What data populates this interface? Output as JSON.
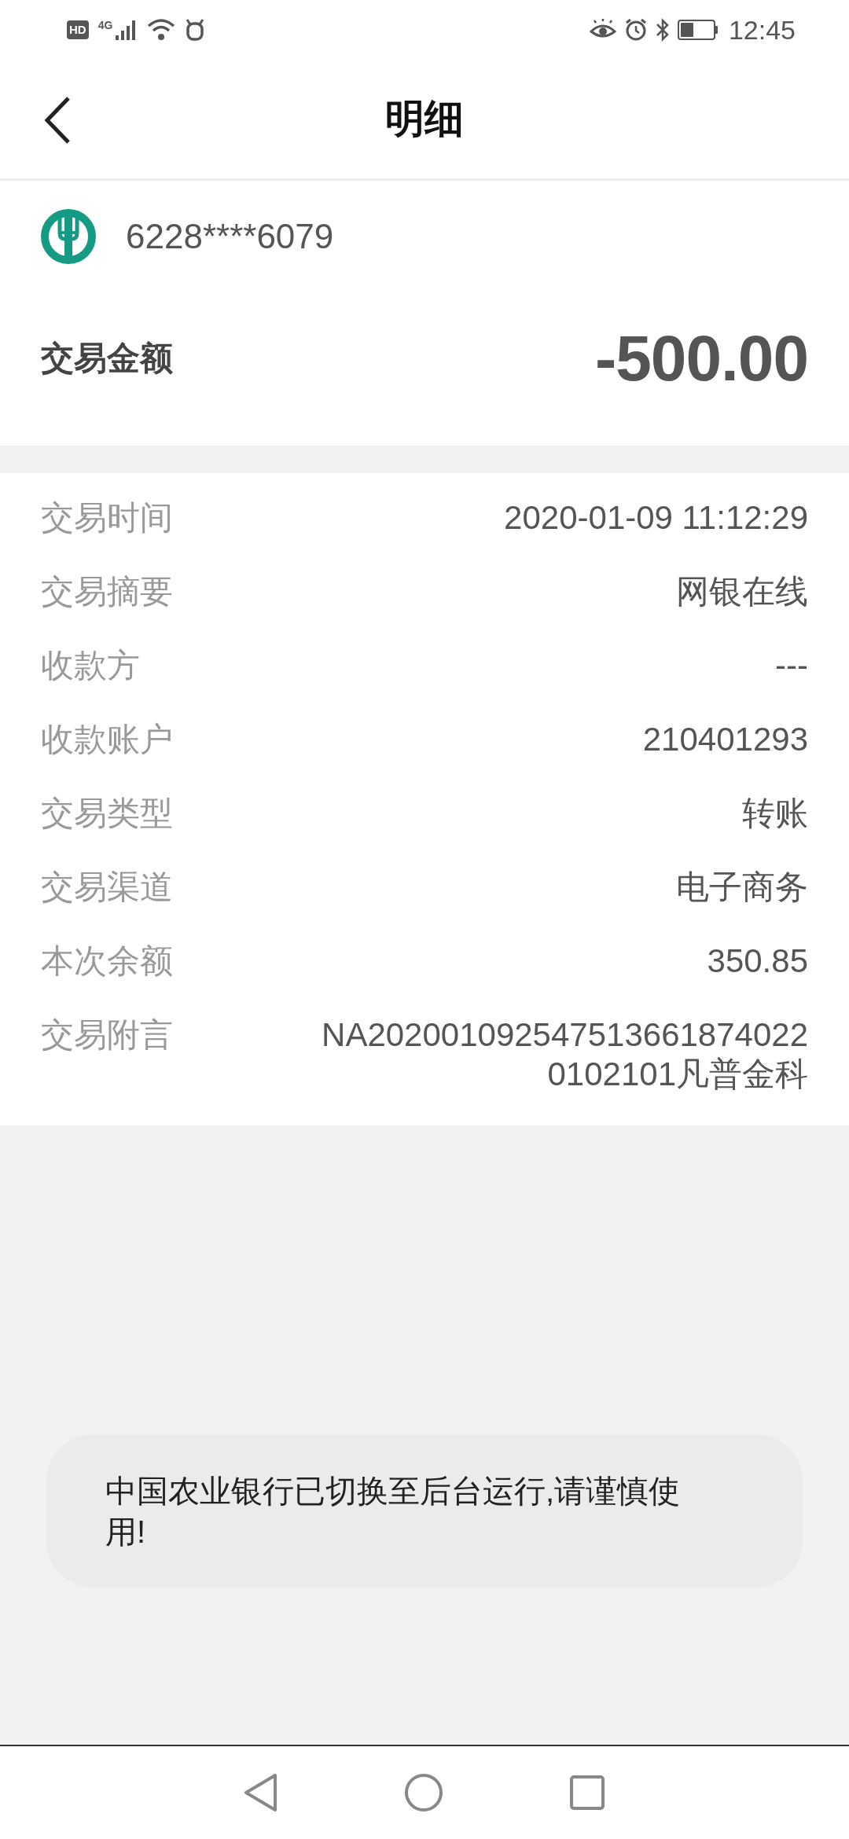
{
  "status_bar": {
    "hd": "HD",
    "network": "4G",
    "time": "12:45"
  },
  "header": {
    "title": "明细"
  },
  "account": {
    "number": "6228****6079"
  },
  "amount": {
    "label": "交易金额",
    "value": "-500.00"
  },
  "details": [
    {
      "label": "交易时间",
      "value": "2020-01-09 11:12:29"
    },
    {
      "label": "交易摘要",
      "value": "网银在线"
    },
    {
      "label": "收款方",
      "value": "---"
    },
    {
      "label": "收款账户",
      "value": "210401293"
    },
    {
      "label": "交易类型",
      "value": "转账"
    },
    {
      "label": "交易渠道",
      "value": "电子商务"
    },
    {
      "label": "本次余额",
      "value": "350.85"
    },
    {
      "label": "交易附言",
      "value": "NA2020010925475136618740220102101凡普金科"
    }
  ],
  "toast": {
    "text": "中国农业银行已切换至后台运行,请谨慎使用!"
  }
}
